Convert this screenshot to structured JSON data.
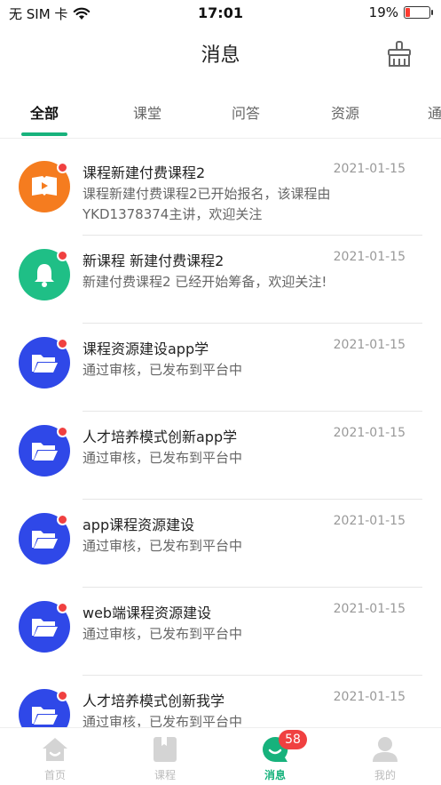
{
  "status_bar": {
    "carrier": "无 SIM 卡",
    "time": "17:01",
    "battery": "19%",
    "battery_level": 0.19,
    "battery_color": "#ff3b30"
  },
  "header": {
    "title": "消息",
    "clear_icon": "broom-icon"
  },
  "tabs": [
    {
      "label": "全部",
      "active": true
    },
    {
      "label": "课堂",
      "active": false
    },
    {
      "label": "问答",
      "active": false
    },
    {
      "label": "资源",
      "active": false
    },
    {
      "label": "通",
      "active": false
    }
  ],
  "accent_color": "#17b27c",
  "messages": [
    {
      "title": "课程新建付费课程2",
      "date": "2021-01-15",
      "desc": "课程新建付费课程2已开始报名，该课程由YKD1378374主讲，欢迎关注",
      "icon": "course-book-icon",
      "color": "#f57c1f",
      "unread": true
    },
    {
      "title": "新课程 新建付费课程2",
      "date": "2021-01-15",
      "desc": "新建付费课程2 已经开始筹备，欢迎关注!",
      "icon": "bell-icon",
      "color": "#1fbf86",
      "unread": true
    },
    {
      "title": "课程资源建设app学",
      "date": "2021-01-15",
      "desc": "通过审核，已发布到平台中",
      "icon": "folder-icon",
      "color": "#2f48e8",
      "unread": true
    },
    {
      "title": "人才培养模式创新app学",
      "date": "2021-01-15",
      "desc": "通过审核，已发布到平台中",
      "icon": "folder-icon",
      "color": "#2f48e8",
      "unread": true
    },
    {
      "title": "app课程资源建设",
      "date": "2021-01-15",
      "desc": "通过审核，已发布到平台中",
      "icon": "folder-icon",
      "color": "#2f48e8",
      "unread": true
    },
    {
      "title": "web端课程资源建设",
      "date": "2021-01-15",
      "desc": "通过审核，已发布到平台中",
      "icon": "folder-icon",
      "color": "#2f48e8",
      "unread": true
    },
    {
      "title": "人才培养模式创新我学",
      "date": "2021-01-15",
      "desc": "通过审核，已发布到平台中",
      "icon": "folder-icon",
      "color": "#2f48e8",
      "unread": true
    }
  ],
  "tabbar": [
    {
      "label": "首页",
      "icon": "home-icon",
      "active": false
    },
    {
      "label": "课程",
      "icon": "book-icon",
      "active": false
    },
    {
      "label": "消息",
      "icon": "chat-icon",
      "active": true,
      "badge": "58"
    },
    {
      "label": "我的",
      "icon": "user-icon",
      "active": false
    }
  ]
}
